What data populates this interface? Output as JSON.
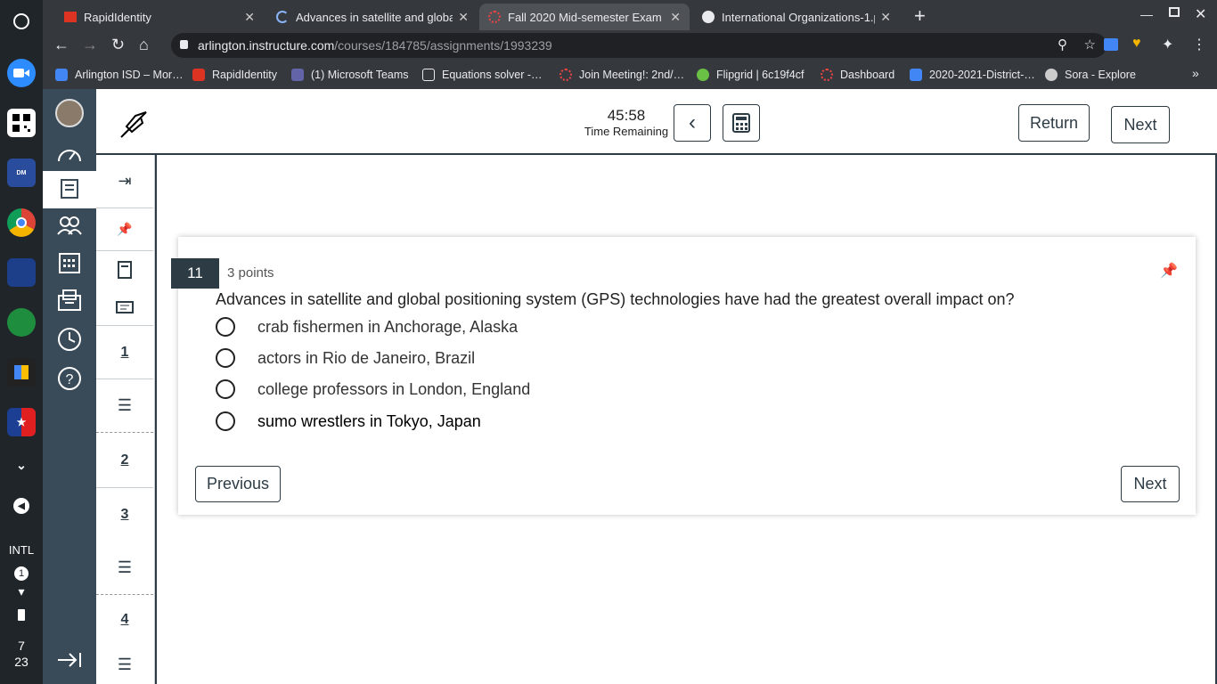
{
  "browser": {
    "tabs": [
      {
        "label": "RapidIdentity"
      },
      {
        "label": "Advances in satellite and global"
      },
      {
        "label": "Fall 2020 Mid-semester Exam"
      },
      {
        "label": "International Organizations-1.pd"
      }
    ],
    "url_host": "arlington.instructure.com",
    "url_path": "/courses/184785/assignments/1993239",
    "bookmarks": [
      "Arlington ISD – Mor…",
      "RapidIdentity",
      "(1) Microsoft Teams",
      "Equations solver -…",
      "Join Meeting!: 2nd/…",
      "Flipgrid | 6c19f4cf",
      "Dashboard",
      "2020-2021-District-…",
      "Sora - Explore"
    ]
  },
  "shelf": {
    "ime": "INTL",
    "notif": "1",
    "time_h": "7",
    "time_m": "23"
  },
  "toolbar": {
    "timer": "45:58",
    "timer_label": "Time Remaining",
    "return_label": "Return",
    "next_label": "Next"
  },
  "course_nav": {
    "items": [
      "1",
      "2",
      "3",
      "4"
    ]
  },
  "question": {
    "number": "11",
    "points": "3 points",
    "text": "Advances in satellite and global positioning system (GPS) technologies have had the greatest overall impact on?",
    "options": [
      "crab fishermen in Anchorage, Alaska",
      "actors in Rio de Janeiro, Brazil",
      "college professors in London, England",
      "sumo wrestlers in Tokyo, Japan"
    ]
  },
  "footer": {
    "previous_label": "Previous",
    "next_label": "Next"
  }
}
